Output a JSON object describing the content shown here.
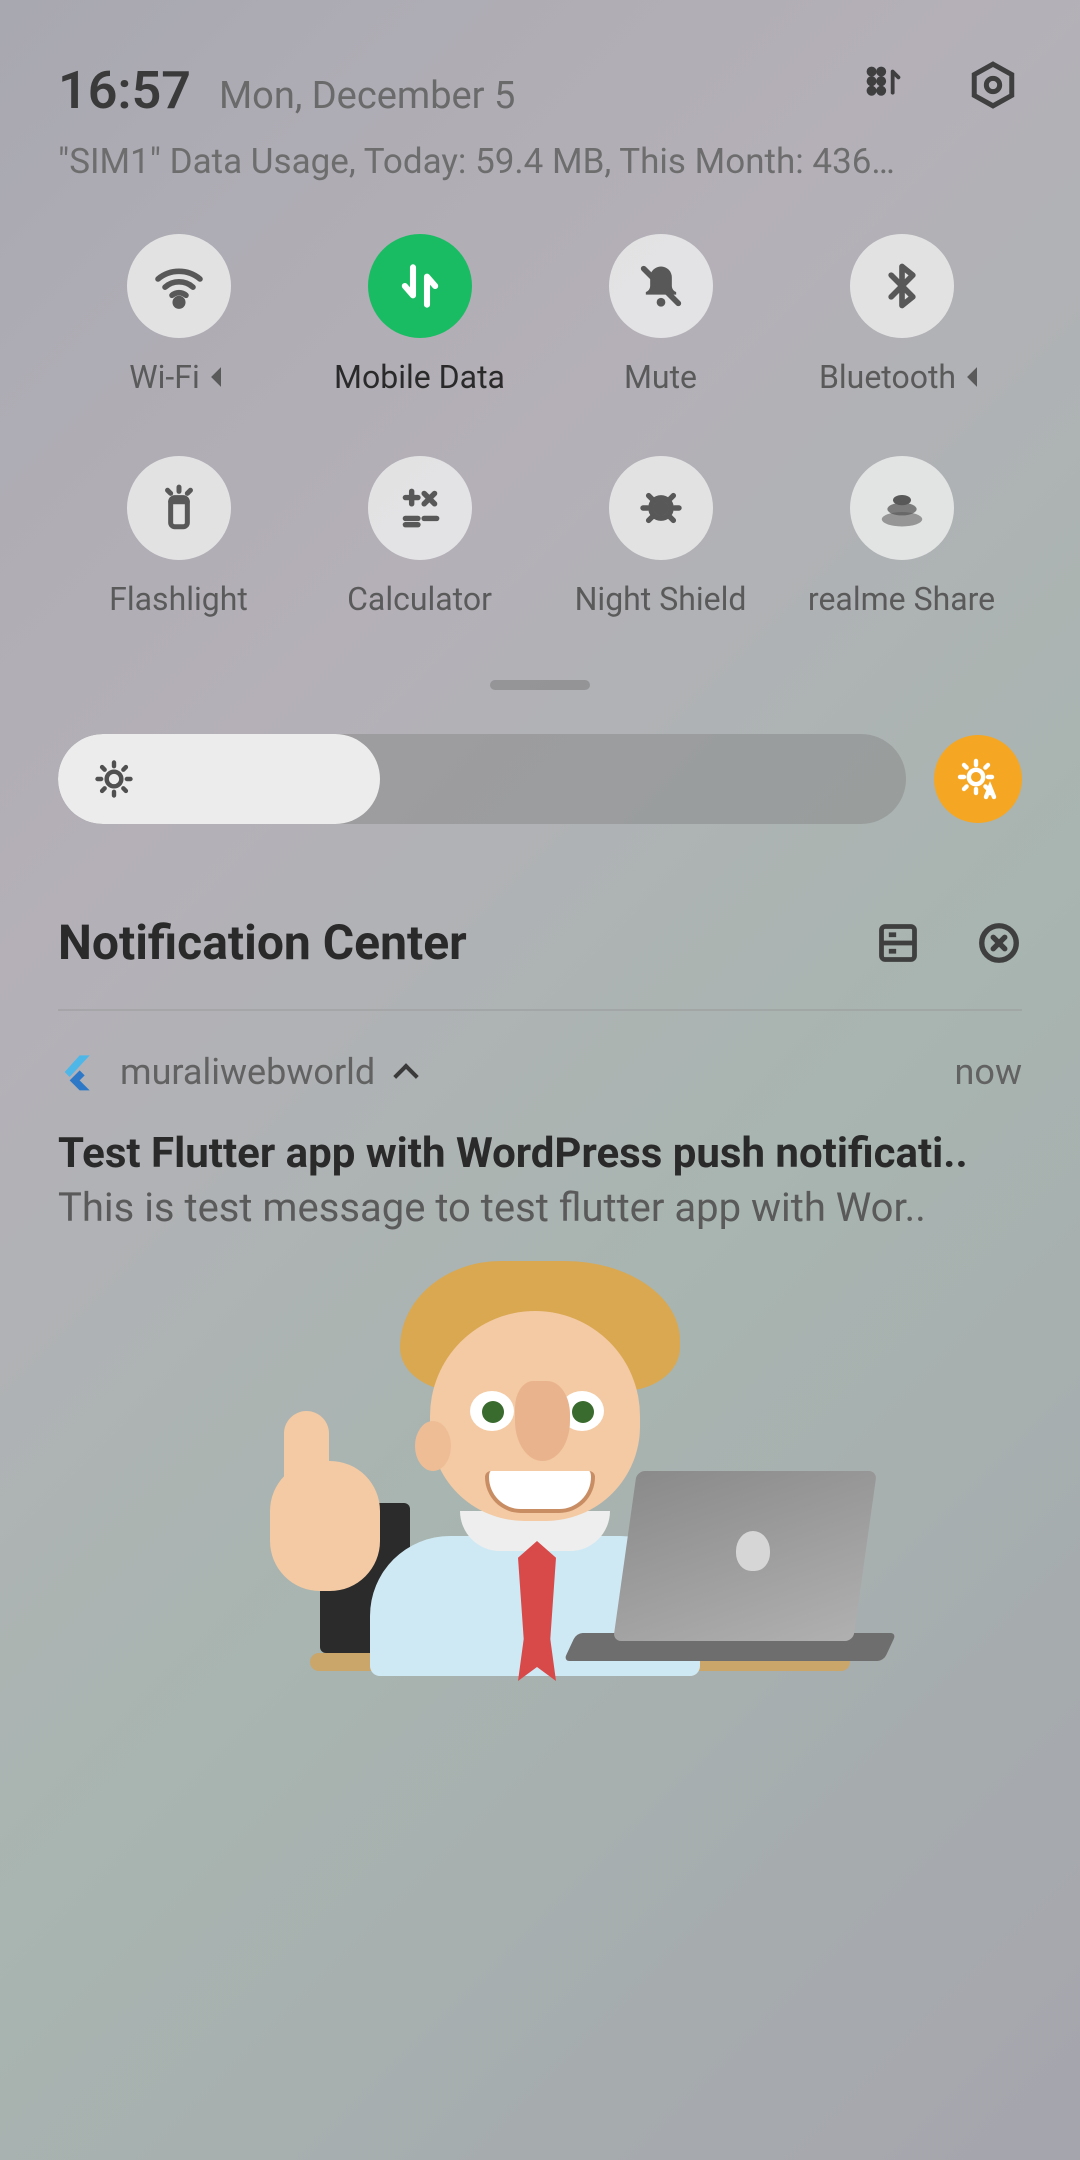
{
  "header": {
    "time": "16:57",
    "date": "Mon, December 5",
    "usage": "\"SIM1\" Data Usage, Today: 59.4 MB, This Month: 436…"
  },
  "toggles": [
    {
      "id": "wifi",
      "label": "Wi-Fi",
      "active": false,
      "expandable": true
    },
    {
      "id": "mobile-data",
      "label": "Mobile Data",
      "active": true,
      "expandable": false
    },
    {
      "id": "mute",
      "label": "Mute",
      "active": false,
      "expandable": false
    },
    {
      "id": "bluetooth",
      "label": "Bluetooth",
      "active": false,
      "expandable": true
    },
    {
      "id": "flashlight",
      "label": "Flashlight",
      "active": false,
      "expandable": false
    },
    {
      "id": "calculator",
      "label": "Calculator",
      "active": false,
      "expandable": false
    },
    {
      "id": "night-shield",
      "label": "Night Shield",
      "active": false,
      "expandable": false
    },
    {
      "id": "realme-share",
      "label": "realme Share",
      "active": false,
      "expandable": false
    }
  ],
  "brightness": {
    "percent": 38,
    "auto_enabled": true
  },
  "notification_center": {
    "title": "Notification Center"
  },
  "notification": {
    "app_name": "muraliwebworld",
    "time": "now",
    "subject": "Test Flutter app with WordPress push notificati..",
    "body": "This is test message to test flutter app with Wor.."
  },
  "colors": {
    "accent_green": "#1abc63",
    "accent_orange": "#f5a623"
  }
}
